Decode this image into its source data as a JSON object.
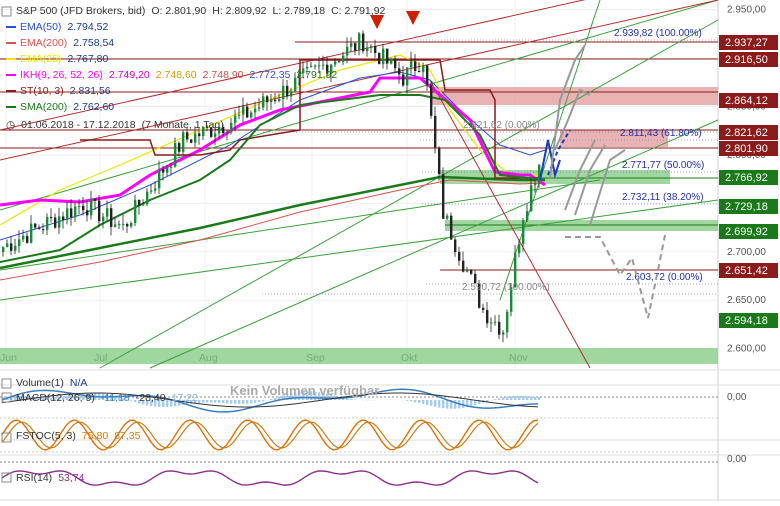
{
  "title": "S&P 500 (JFD Brokers, bid)",
  "ohlc": {
    "o": "O: 2.801,90",
    "h": "H: 2.809,92",
    "l": "L: 2.789,18",
    "c": "C: 2.791,92"
  },
  "legend": [
    {
      "label": "EMA(50)",
      "values": [
        "2.794,52"
      ],
      "color": "#2b4fd6"
    },
    {
      "label": "EMA(200)",
      "values": [
        "2.758,54"
      ],
      "color": "#d9534f"
    },
    {
      "label": "EMA(25)",
      "values": [
        "2.767,80"
      ],
      "color": "#e8e800"
    },
    {
      "label": "IKH(9, 26, 52, 26)",
      "values": [
        "2.749,20",
        "2.748,60",
        "2.748,90",
        "2.772,35",
        "2.791,92"
      ],
      "value_colors": [
        "#d000d0",
        "#c8a000",
        "#c05050",
        "#3050c0",
        "#207020"
      ],
      "color": "#ff00ff"
    },
    {
      "label": "ST(10, 3)",
      "values": [
        "2.831,56"
      ],
      "color": "#8b1a1a"
    },
    {
      "label": "SMA(200)",
      "values": [
        "2.762,60"
      ],
      "color": "#1a7a1a"
    }
  ],
  "period": {
    "range": "01.06.2018 - 17.12.2018",
    "detail": "(7 Monate, 1 Tag)"
  },
  "x_months": [
    "Jun",
    "Jul",
    "Aug",
    "Sep",
    "Okt",
    "Nov"
  ],
  "y_ticks": [
    "2.950,00",
    "2.900,00",
    "2.850,00",
    "2.800,00",
    "2.750,00",
    "2.700,00",
    "2.650,00",
    "2.600,00"
  ],
  "price_badges": [
    {
      "label": "2.937,27",
      "color": "#8b1a1a"
    },
    {
      "label": "2.916,50",
      "color": "#8b1a1a"
    },
    {
      "label": "2.864,12",
      "color": "#8b1a1a"
    },
    {
      "label": "2.821,62",
      "color": "#8b1a1a"
    },
    {
      "label": "2.801,90",
      "color": "#8b1a1a"
    },
    {
      "label": "2.766,92",
      "color": "#1a7a1a"
    },
    {
      "label": "2.729,18",
      "color": "#1a7a1a"
    },
    {
      "label": "2.699,92",
      "color": "#1a7a1a"
    },
    {
      "label": "2.651,42",
      "color": "#8b1a1a"
    },
    {
      "label": "2.594,18",
      "color": "#1a7a1a"
    }
  ],
  "fib_labels": [
    {
      "text": "2.939,82 (100.00%)"
    },
    {
      "text": "2.821,62 (0.00%)"
    },
    {
      "text": "2.811,43 (61.80%)"
    },
    {
      "text": "2.771,77 (50.00%)"
    },
    {
      "text": "2.732,11 (38.20%)"
    },
    {
      "text": "2.603,72 (0.00%)"
    },
    {
      "text": "2.590,72 (100.00%)"
    }
  ],
  "volume": {
    "title": "Volume(1)",
    "value": "N/A",
    "empty_text": "Kein Volumen verfügbar"
  },
  "macd": {
    "title": "MACD(12, 26, 9)",
    "values": [
      "-11,18",
      "-28,40",
      "17,22"
    ],
    "value_colors": [
      "#3a7fbf",
      "#333333",
      "#7fb8e6"
    ],
    "y_ticks": [
      "0,00",
      "0,00"
    ]
  },
  "fstoc": {
    "title": "FSTOC(5, 3)",
    "values": [
      "75,80",
      "87,35"
    ],
    "value_colors": [
      "#e07000",
      "#c08020"
    ]
  },
  "rsi": {
    "title": "RSI(14)",
    "value": "53,74",
    "color": "#8b2f8b"
  },
  "chart_data": {
    "type": "candlestick",
    "title": "S&P 500 (JFD Brokers, bid)",
    "period": "01.06.2018 - 17.12.2018",
    "x_range": [
      "2018-06-01",
      "2018-12-17"
    ],
    "y_range": [
      2580,
      2960
    ],
    "months": [
      "Jun",
      "Jul",
      "Aug",
      "Sep",
      "Okt",
      "Nov"
    ],
    "last": {
      "open": 2801.9,
      "high": 2809.92,
      "low": 2789.18,
      "close": 2791.92
    },
    "indicators": {
      "EMA(50)": 2794.52,
      "EMA(200)": 2758.54,
      "EMA(25)": 2767.8,
      "SMA(200)": 2762.6,
      "ST(10,3)": 2831.56
    },
    "horizontal_levels": [
      2937.27,
      2916.5,
      2864.12,
      2821.62,
      2801.9,
      2766.92,
      2729.18,
      2699.92,
      2651.42,
      2594.18
    ],
    "fibonacci": [
      {
        "level": 2939.82,
        "pct": "100.00%"
      },
      {
        "level": 2811.43,
        "pct": "61.80%"
      },
      {
        "level": 2771.77,
        "pct": "50.00%"
      },
      {
        "level": 2732.11,
        "pct": "38.20%"
      },
      {
        "level": 2603.72,
        "pct": "0.00%"
      }
    ]
  }
}
